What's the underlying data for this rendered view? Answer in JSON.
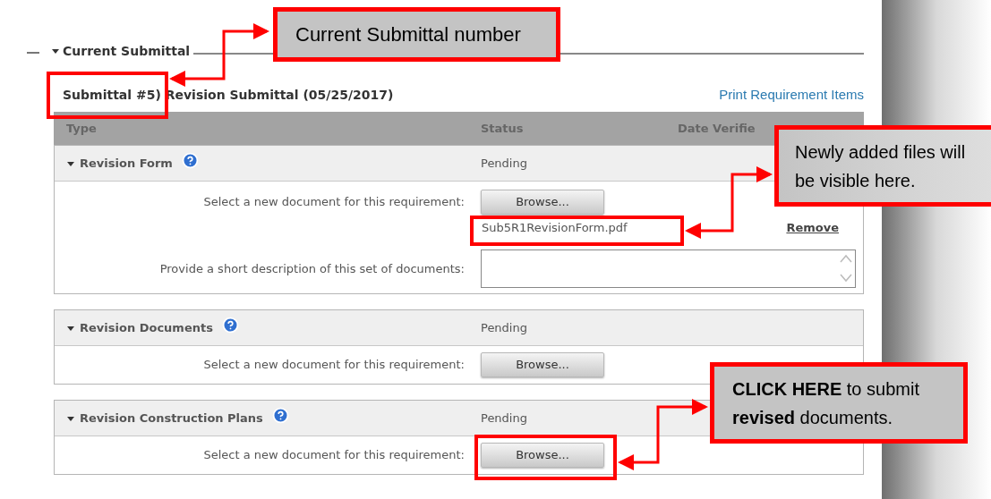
{
  "section": {
    "title": "Current Submittal",
    "expanded": true
  },
  "submittal": {
    "heading": "Submittal #5) Revision Submittal (05/25/2017)",
    "print_link": "Print Requirement Items"
  },
  "table": {
    "columns": [
      "Type",
      "Status",
      "Date Verifie"
    ]
  },
  "requirements": [
    {
      "name": "Revision Form",
      "expanded": true,
      "status": "Pending",
      "prompt": "Select a new document for this requirement:",
      "button": "Browse...",
      "files": [
        {
          "name": "Sub5R1RevisionForm.pdf",
          "action": "Remove"
        }
      ],
      "description": {
        "label": "Provide a short description of this set of documents:"
      }
    },
    {
      "name": "Revision Documents",
      "expanded": true,
      "status": "Pending",
      "prompt": "Select a new document for this requirement:",
      "button": "Browse..."
    },
    {
      "name": "Revision Construction Plans",
      "expanded": true,
      "status": "Pending",
      "prompt": "Select a new document for this requirement:",
      "button": "Browse..."
    }
  ],
  "annotations": [
    {
      "text": "Current Submittal number"
    },
    {
      "text": "Newly added files will be visible here."
    },
    {
      "text": "**CLICK HERE** to submit **revised** documents."
    }
  ]
}
